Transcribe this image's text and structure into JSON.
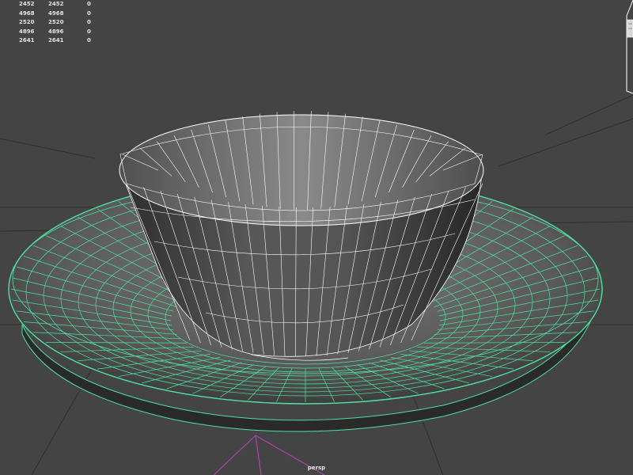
{
  "viewport": {
    "camera_label": "persp",
    "background": "#444444",
    "wire_selected_color": "#4fe0a6",
    "wire_unselected_color": "#ffffff",
    "grid_color": "#2a2a2a"
  },
  "hud": {
    "rows": [
      {
        "c1": "2452",
        "c2": "2452",
        "c3": "0"
      },
      {
        "c1": "4968",
        "c2": "4968",
        "c3": "0"
      },
      {
        "c1": "2520",
        "c2": "2520",
        "c3": "0"
      },
      {
        "c1": "4896",
        "c2": "4896",
        "c3": "0"
      },
      {
        "c1": "2641",
        "c2": "2641",
        "c3": "0"
      }
    ]
  },
  "icons": {
    "viewcube": "view-cube-icon",
    "origin_axis": "origin-axis-icon"
  }
}
